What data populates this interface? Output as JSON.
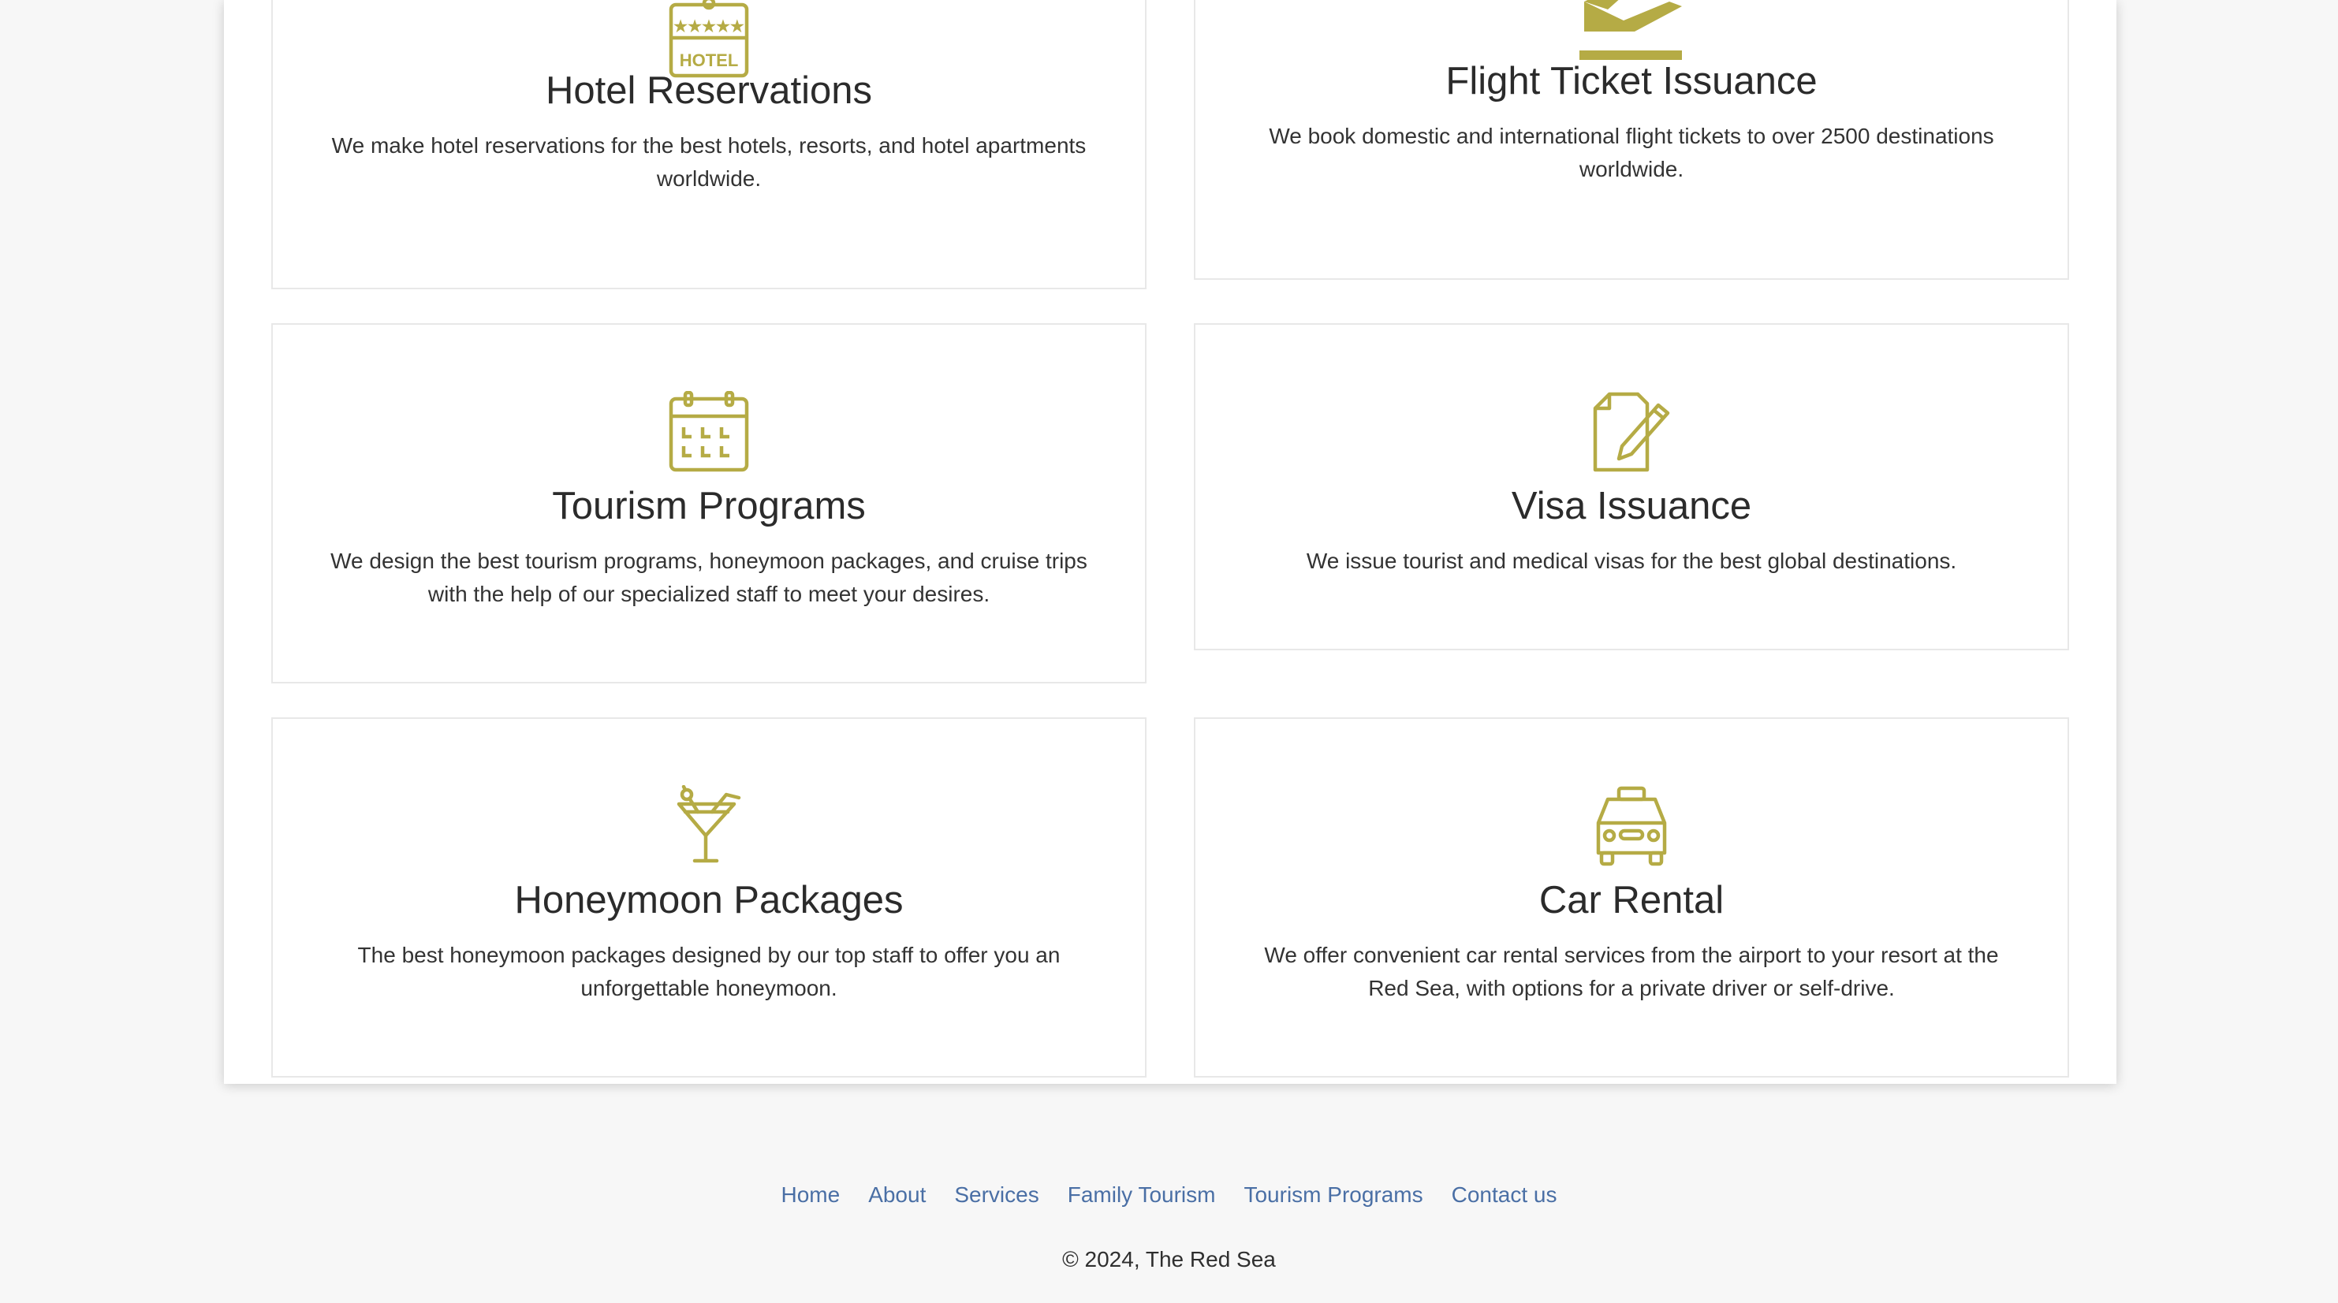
{
  "accent_color": "#b5ab45",
  "services": [
    {
      "icon": "hotel-icon",
      "title": "Hotel Reservations",
      "description": "We make hotel reservations for the best hotels, resorts, and hotel apartments worldwide.",
      "icon_text": "HOTEL"
    },
    {
      "icon": "airplane-departure-icon",
      "title": "Flight Ticket Issuance",
      "description": "We book domestic and international flight tickets to over 2500 destinations worldwide."
    },
    {
      "icon": "calendar-icon",
      "title": "Tourism Programs",
      "description": "We design the best tourism programs, honeymoon packages, and cruise trips with the help of our specialized staff to meet your desires."
    },
    {
      "icon": "document-edit-icon",
      "title": "Visa Issuance",
      "description": "We issue tourist and medical visas for the best global destinations."
    },
    {
      "icon": "cocktail-icon",
      "title": "Honeymoon Packages",
      "description": "The best honeymoon packages designed by our top staff to offer you an unforgettable honeymoon."
    },
    {
      "icon": "taxi-icon",
      "title": "Car Rental",
      "description": "We offer convenient car rental services from the airport to your resort at the Red Sea, with options for a private driver or self-drive."
    }
  ],
  "footer": {
    "links": [
      "Home",
      "About",
      "Services",
      "Family Tourism",
      "Tourism Programs",
      "Contact us"
    ],
    "copyright": "© 2024, The Red Sea"
  }
}
